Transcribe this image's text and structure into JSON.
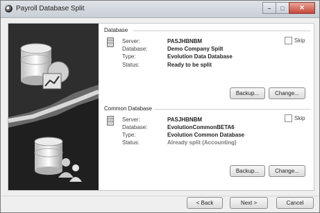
{
  "window": {
    "title": "Payroll Database Split"
  },
  "database": {
    "group_label": "Database",
    "server_label": "Server:",
    "server": "PASJHBNBM",
    "database_label": "Database:",
    "database": "Demo Company Spilt",
    "type_label": "Type:",
    "type": "Evolution Data Database",
    "status_label": "Status:",
    "status": "Ready to be split",
    "skip_label": "Skip",
    "backup_label": "Backup...",
    "change_label": "Change..."
  },
  "common": {
    "group_label": "Common Database",
    "server_label": "Server:",
    "server": "PASJHBNBM",
    "database_label": "Database:",
    "database": "EvolutionCommonBETA6",
    "type_label": "Type:",
    "type": "Evolution Common Database",
    "status_label": "Status:",
    "status": "Already split (Accounting)",
    "skip_label": "Skip",
    "backup_label": "Backup...",
    "change_label": "Change..."
  },
  "footer": {
    "back_label": "< Back",
    "next_label": "Next >",
    "cancel_label": "Cancel"
  }
}
